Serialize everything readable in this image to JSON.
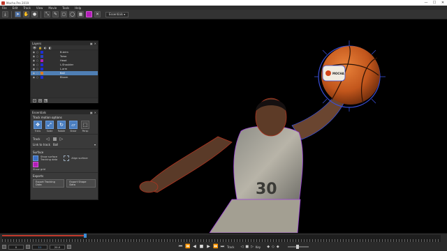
{
  "window": {
    "title": "Mocha Pro 2019",
    "minimize": "—",
    "maximize": "☐",
    "close": "✕"
  },
  "menu": [
    "File",
    "Edit",
    "Track",
    "View",
    "Movie",
    "Tools",
    "Help"
  ],
  "toolbar": {
    "workspace": "Essentials ▾"
  },
  "layers_panel": {
    "title": "Layers",
    "header_buttons": [
      "▣",
      "✕"
    ],
    "tool_icons": [
      "👁",
      "🔒",
      "◐",
      "◧"
    ],
    "rows": [
      {
        "name": "B.brim",
        "color": "#1c2fd8",
        "selected": false
      },
      {
        "name": "Torso",
        "color": "#2642c4",
        "selected": false
      },
      {
        "name": "Head",
        "color": "#b21fb8",
        "selected": false
      },
      {
        "name": "L.Shoulder",
        "color": "#1c2fd8",
        "selected": false
      },
      {
        "name": "L.arm",
        "color": "#1c2fd8",
        "selected": false
      },
      {
        "name": "Ball",
        "color": "#e07a1c",
        "selected": true
      },
      {
        "name": "Bloom",
        "color": "#1c2fd8",
        "selected": false
      }
    ],
    "footer_icons": [
      "+",
      "▤",
      "🗑"
    ]
  },
  "essentials": {
    "title": "Essentials",
    "motion_title": "Track motion options",
    "motion": [
      {
        "label": "Trans",
        "glyph": "✥",
        "on": true
      },
      {
        "label": "Scale",
        "glyph": "⤢",
        "on": true
      },
      {
        "label": "Rotate",
        "glyph": "↻",
        "on": true
      },
      {
        "label": "Shear",
        "glyph": "▱",
        "on": true
      },
      {
        "label": "Persp",
        "glyph": "⬚",
        "on": false
      }
    ],
    "track_label": "Track",
    "link_label": "Link to track",
    "link_value": "Ball",
    "surface_title": "Surface",
    "show_surface": "Show surface",
    "tracking_data": "Tracking data",
    "align_surface": "Align surface",
    "show_grid": "Show grid",
    "exports_title": "Exports",
    "export_tracking": "Export Tracking Data",
    "export_shape": "Export Shape Data"
  },
  "timeline": {
    "in_field": "0",
    "current_field": "11",
    "out_field": "",
    "frame_field": "",
    "end_field": "20.0",
    "track_label": "Track",
    "key_label": "Key"
  },
  "canvas": {
    "ball_logo": "MOCHA"
  }
}
